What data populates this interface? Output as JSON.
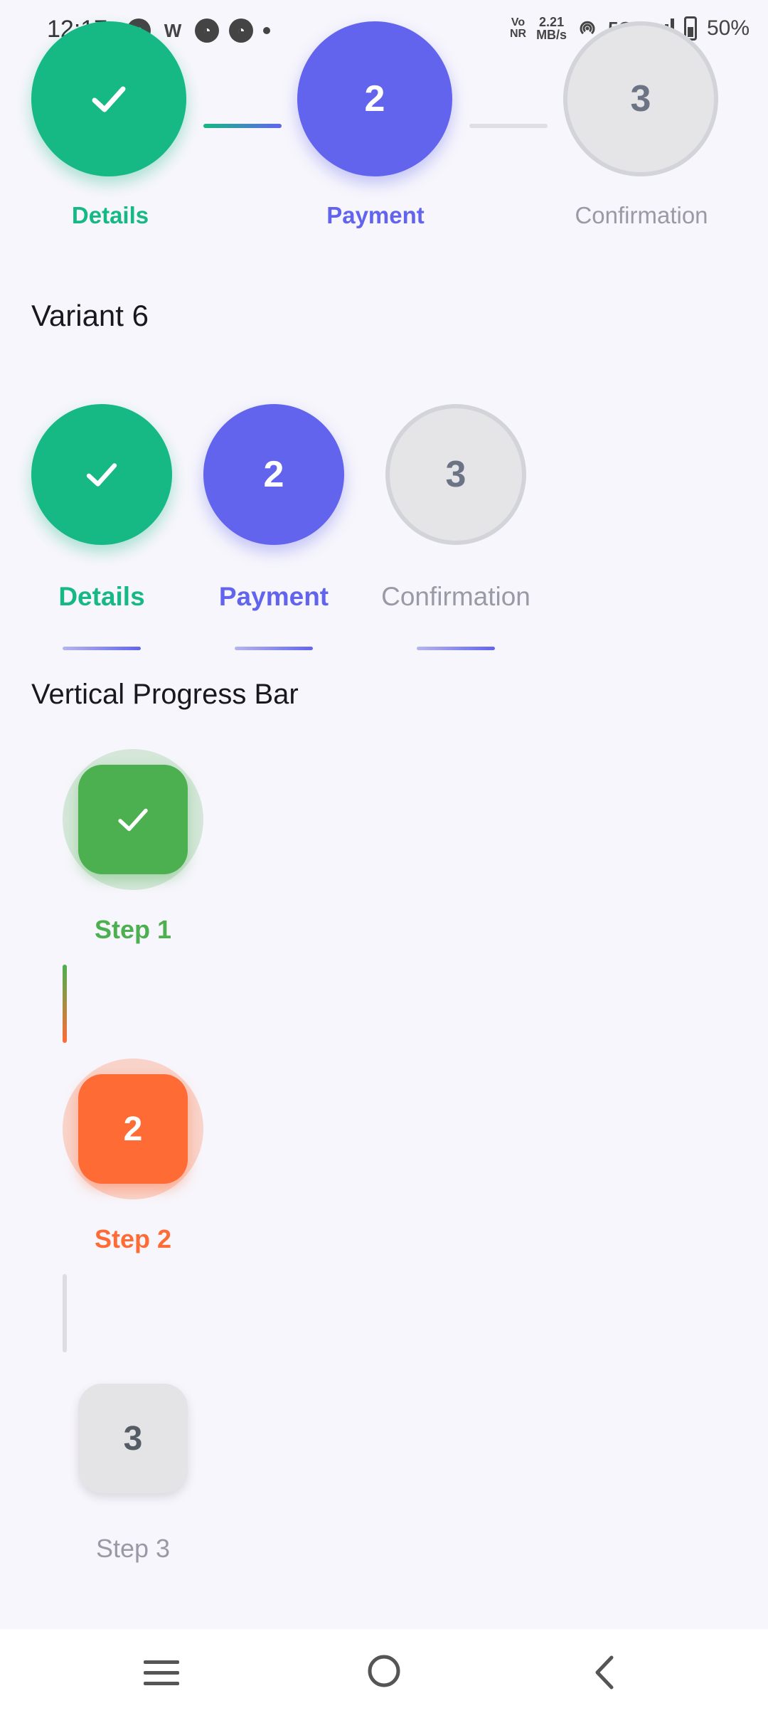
{
  "status": {
    "time": "12:17",
    "network_top": "Vo",
    "network_bottom": "NR",
    "speed_value": "2.21",
    "speed_unit": "MB/s",
    "network_type": "5G+",
    "battery": "50%"
  },
  "stepper_top": {
    "steps": [
      {
        "label": "Details",
        "state": "done",
        "color": "#16b883"
      },
      {
        "label": "Payment",
        "number": "2",
        "state": "active",
        "color": "#6264ee"
      },
      {
        "label": "Confirmation",
        "number": "3",
        "state": "pending",
        "color": "#9a9aa6"
      }
    ]
  },
  "variant6": {
    "title": "Variant 6",
    "steps": [
      {
        "label": "Details",
        "state": "done"
      },
      {
        "label": "Payment",
        "number": "2",
        "state": "active"
      },
      {
        "label": "Confirmation",
        "number": "3",
        "state": "pending"
      }
    ]
  },
  "vertical": {
    "title": "Vertical Progress Bar",
    "steps": [
      {
        "label": "Step 1",
        "state": "done",
        "color": "#4caf50"
      },
      {
        "label": "Step 2",
        "number": "2",
        "state": "active",
        "color": "#ff6b35"
      },
      {
        "label": "Step 3",
        "number": "3",
        "state": "pending",
        "color": "#9a9aa6"
      }
    ]
  },
  "nav": {
    "icons": [
      "menu-icon",
      "home-icon",
      "back-icon"
    ]
  }
}
